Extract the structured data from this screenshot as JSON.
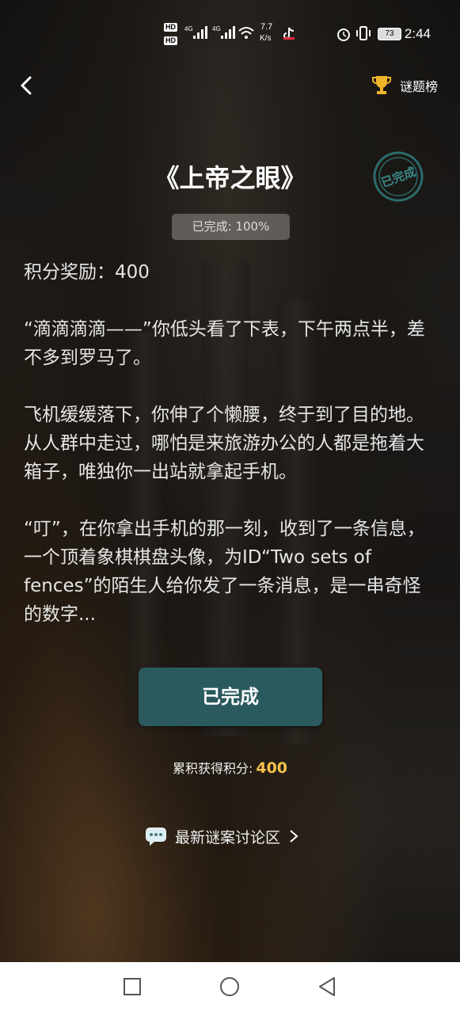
{
  "status_bar": {
    "net_speed_value": "7.7",
    "net_speed_unit": "K/s",
    "network_label_1": "4G",
    "network_label_2": "4G",
    "hd_label": "HD",
    "battery": "73",
    "time": "2:44"
  },
  "header": {
    "rank_label": "谜题榜"
  },
  "puzzle": {
    "title": "《上帝之眼》",
    "stamp_text": "已完成",
    "progress": "已完成: 100%",
    "reward": "积分奖励：400",
    "paragraphs": [
      "“滴滴滴滴——”你低头看了下表，下午两点半，差不多到罗马了。",
      "飞机缓缓落下，你伸了个懒腰，终于到了目的地。从人群中走过，哪怕是来旅游办公的人都是拖着大箱子，唯独你一出站就拿起手机。",
      "“叮”，在你拿出手机的那一刻，收到了一条信息，一个顶着象棋棋盘头像，为ID“Two sets of fences”的陌生人给你发了一条消息，是一串奇怪的数字..."
    ]
  },
  "actions": {
    "done_button": "已完成",
    "total_label": "累积获得积分:",
    "total_value": "400",
    "discussion_label": "最新谜案讨论区"
  },
  "colors": {
    "button_bg": "#2b5a5e",
    "points_accent": "#f5c24a",
    "trophy": "#f0b429",
    "stamp": "#2b6b6b"
  },
  "icons": {
    "back": "chevron-left-icon",
    "rank": "trophy-icon",
    "discussion": "chat-bubble-icon",
    "discussion_arrow": "chevron-right-icon",
    "nav_recent": "square-icon",
    "nav_home": "circle-icon",
    "nav_back": "triangle-back-icon"
  }
}
